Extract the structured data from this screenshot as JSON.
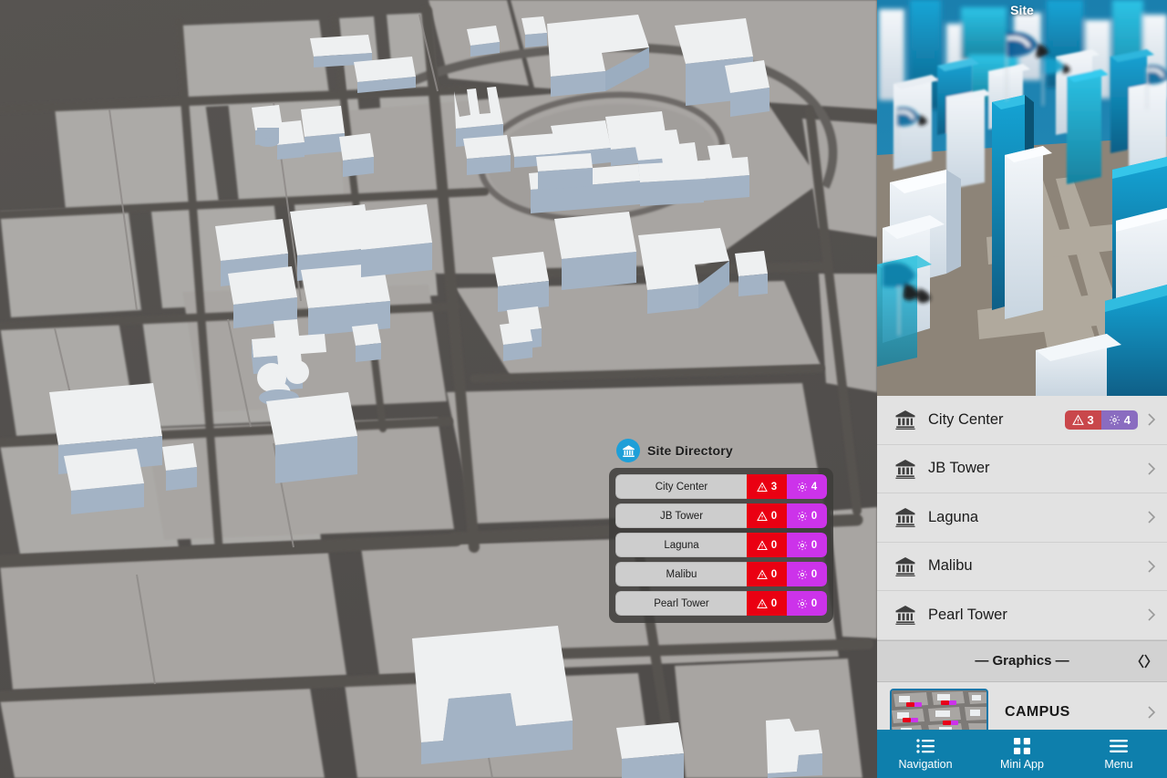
{
  "map": {
    "name": "3d-city-map",
    "background_color": "#555250",
    "block_color": "#a8a5a2",
    "building_top_color": "#f0f1f2",
    "building_side_color": "#a8b4c4"
  },
  "directory_overlay": {
    "title": "Site Directory",
    "header_icon": "bank-icon",
    "alert_icon": "warning-triangle-icon",
    "gear_icon": "gear-icon",
    "alert_color": "#ea0012",
    "gear_color": "#cc33ea",
    "rows": [
      {
        "name": "City Center",
        "alerts": "3",
        "tasks": "4"
      },
      {
        "name": "JB Tower",
        "alerts": "0",
        "tasks": "0"
      },
      {
        "name": "Laguna",
        "alerts": "0",
        "tasks": "0"
      },
      {
        "name": "Malibu",
        "alerts": "0",
        "tasks": "0"
      },
      {
        "name": "Pearl Tower",
        "alerts": "0",
        "tasks": "0"
      }
    ]
  },
  "side_panel": {
    "hero": {
      "title": "Site",
      "image": "3d-city-render"
    },
    "sites": [
      {
        "name": "City Center",
        "icon": "bank-icon",
        "has_badges": true,
        "alerts": "3",
        "tasks": "4"
      },
      {
        "name": "JB Tower",
        "icon": "bank-icon",
        "has_badges": false,
        "alerts": "",
        "tasks": ""
      },
      {
        "name": "Laguna",
        "icon": "bank-icon",
        "has_badges": false,
        "alerts": "",
        "tasks": ""
      },
      {
        "name": "Malibu",
        "icon": "bank-icon",
        "has_badges": false,
        "alerts": "",
        "tasks": ""
      },
      {
        "name": "Pearl Tower",
        "icon": "bank-icon",
        "has_badges": false,
        "alerts": "",
        "tasks": ""
      }
    ],
    "badge_alert_color": "#c9474b",
    "badge_gear_color": "#8a6cc0",
    "graphics_header": {
      "label": "— Graphics —",
      "action_icon": "code-brackets-icon"
    },
    "graphics_items": [
      {
        "label": "CAMPUS",
        "thumbnail": "campus-map-thumbnail",
        "selected": true
      }
    ]
  },
  "tabbar": {
    "accent_color": "#0e7fac",
    "tabs": [
      {
        "label": "Navigation",
        "icon": "list-icon"
      },
      {
        "label": "Mini App",
        "icon": "grid-icon"
      },
      {
        "label": "Menu",
        "icon": "hamburger-icon"
      }
    ]
  }
}
